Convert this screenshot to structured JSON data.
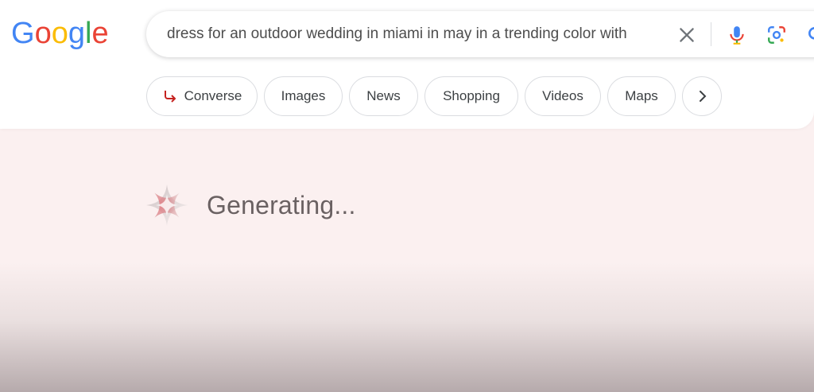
{
  "logo": {
    "text": "Google"
  },
  "search": {
    "query": "dress for an outdoor wedding in miami in may in a trending color with"
  },
  "icons": {
    "clear": "close-icon",
    "voice": "microphone-icon",
    "lens": "lens-camera-icon",
    "search": "search-icon"
  },
  "chips": [
    {
      "label": "Converse",
      "icon": "converse-arrow-icon"
    },
    {
      "label": "Images"
    },
    {
      "label": "News"
    },
    {
      "label": "Shopping"
    },
    {
      "label": "Videos"
    },
    {
      "label": "Maps"
    },
    {
      "label": "",
      "icon": "chevron-right-icon"
    }
  ],
  "status": {
    "text": "Generating...",
    "icon": "sparkle-icon"
  },
  "colors": {
    "page_bg": "#fbf0f0",
    "google_blue": "#4285F4",
    "google_red": "#EA4335",
    "google_yellow": "#FBBC05",
    "google_green": "#34A853",
    "converse_arrow": "#c5221f"
  }
}
